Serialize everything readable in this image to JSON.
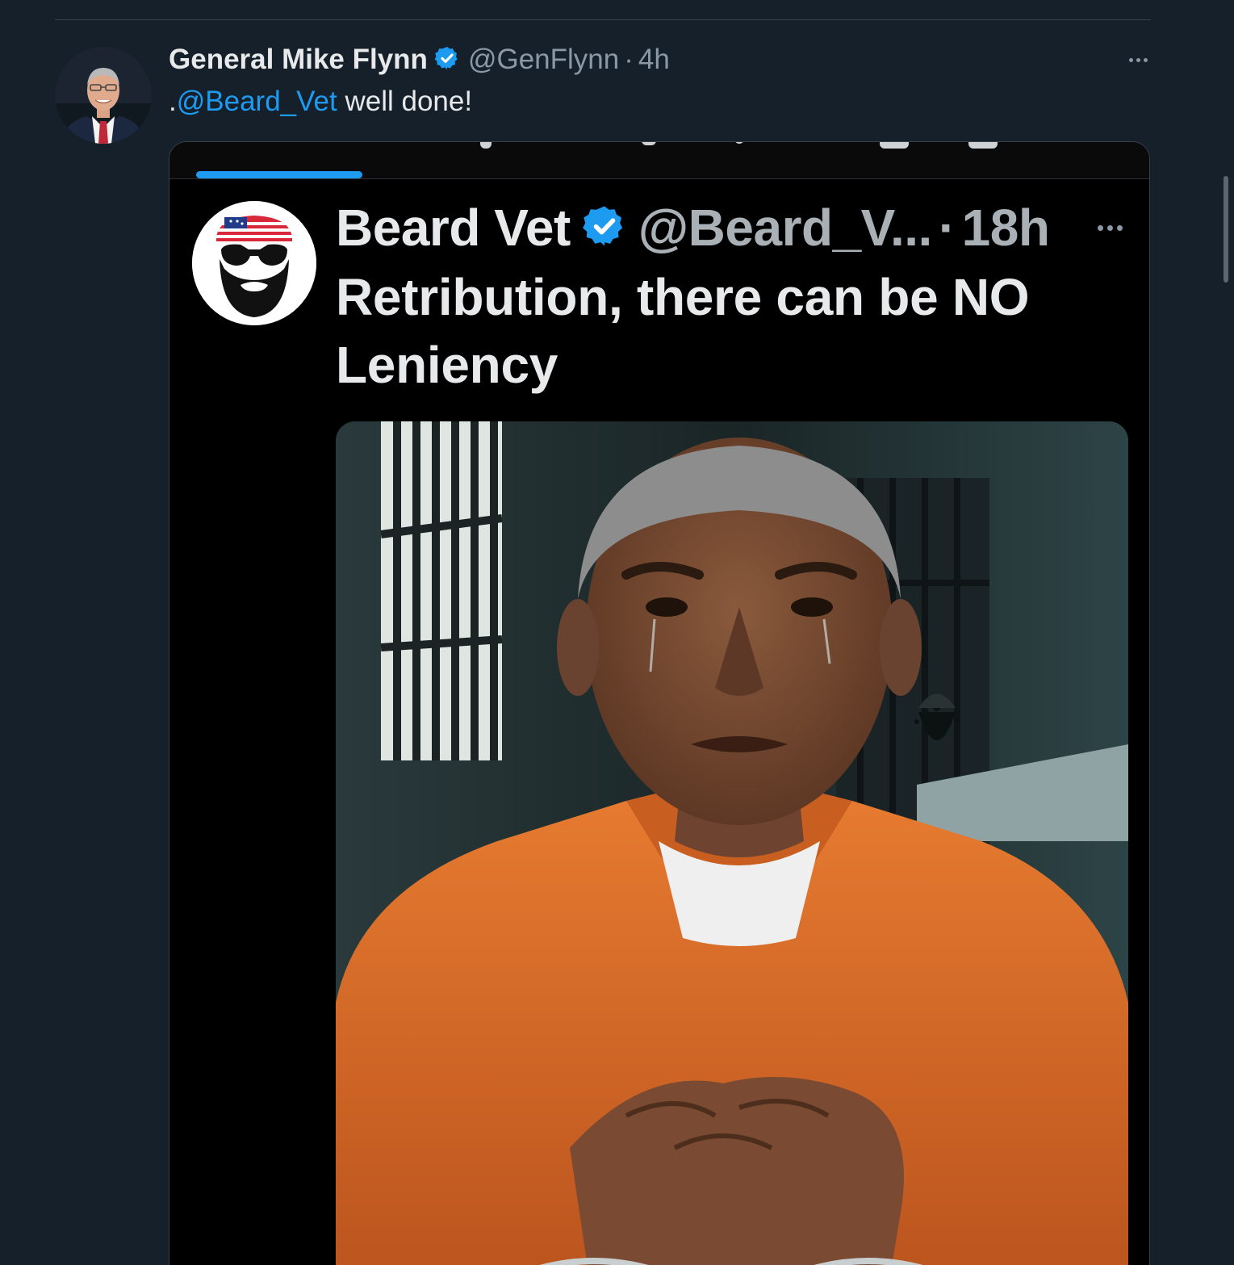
{
  "tweet": {
    "author_name": "General Mike Flynn",
    "author_handle": "@GenFlynn",
    "separator": "·",
    "timestamp": "4h",
    "text_prefix": ".",
    "mention": "@Beard_Vet",
    "text_suffix": " well done!",
    "verified": true
  },
  "embedded": {
    "author_name": "Beard Vet",
    "author_handle": "@Beard_V...",
    "separator": "·",
    "timestamp": "18h",
    "text": "Retribution, there can be NO Leniency",
    "verified": true,
    "photo_subject": "person in orange jumpsuit in jail cell"
  },
  "colors": {
    "background": "#15202b",
    "accent": "#1d9bf0",
    "text_primary": "#e7e9ea",
    "text_secondary": "#8b98a5",
    "jumpsuit": "#e2712a"
  },
  "icons": [
    "verified-badge-icon",
    "more-options-icon"
  ]
}
